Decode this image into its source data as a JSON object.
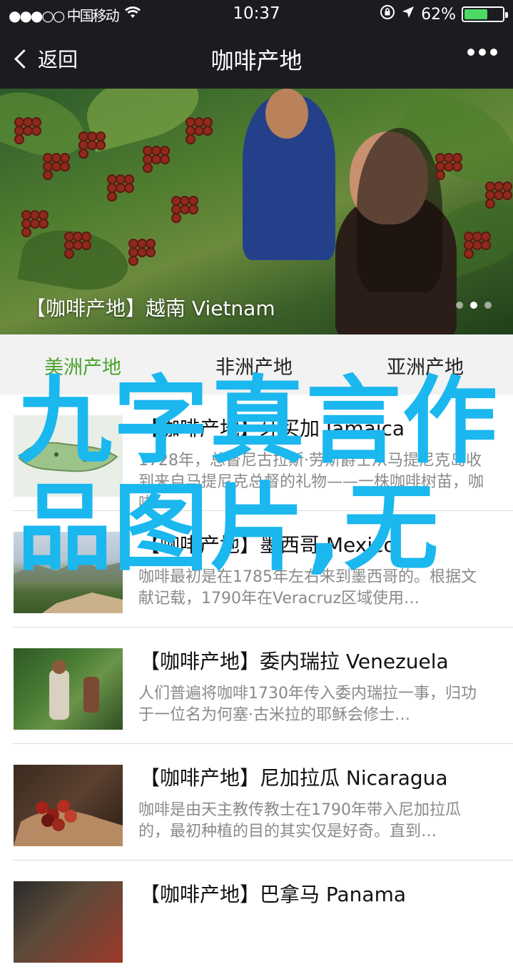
{
  "status_bar": {
    "carrier": "●●●○○ 中国移动",
    "time": "10:37",
    "battery_text": "62%",
    "battery_level": 0.62
  },
  "nav": {
    "back_label": "返回",
    "title": "咖啡产地"
  },
  "banner": {
    "caption": "【咖啡产地】越南 Vietnam",
    "page_count": 3,
    "active_page": 1
  },
  "tabs": [
    {
      "label": "美洲产地",
      "active": true
    },
    {
      "label": "非洲产地",
      "active": false
    },
    {
      "label": "亚洲产地",
      "active": false
    }
  ],
  "list": [
    {
      "title": "【咖啡产地】牙买加 Jamaica",
      "desc": "1728年，总督尼古拉斯·劳斯爵士从马提尼克岛收到来自马提尼克总督的礼物——一株咖啡树苗，咖啡…"
    },
    {
      "title": "【咖啡产地】墨西哥 Mexico",
      "desc": "咖啡最初是在1785年左右来到墨西哥的。根据文献记载，1790年在Veracruz区域使用…"
    },
    {
      "title": "【咖啡产地】委内瑞拉 Venezuela",
      "desc": "人们普遍将咖啡1730年传入委内瑞拉一事，归功于一位名为何塞·古米拉的耶稣会修士…"
    },
    {
      "title": "【咖啡产地】尼加拉瓜 Nicaragua",
      "desc": "咖啡是由天主教传教士在1790年带入尼加拉瓜的，最初种植的目的其实仅是好奇。直到…"
    },
    {
      "title": "【咖啡产地】巴拿马 Panama",
      "desc": ""
    }
  ],
  "overlay_text": "九字真言作品图片,无",
  "colors": {
    "accent_green": "#4aa32c",
    "overlay_blue": "#1bb7ef",
    "nav_bg": "#1b1c20"
  }
}
